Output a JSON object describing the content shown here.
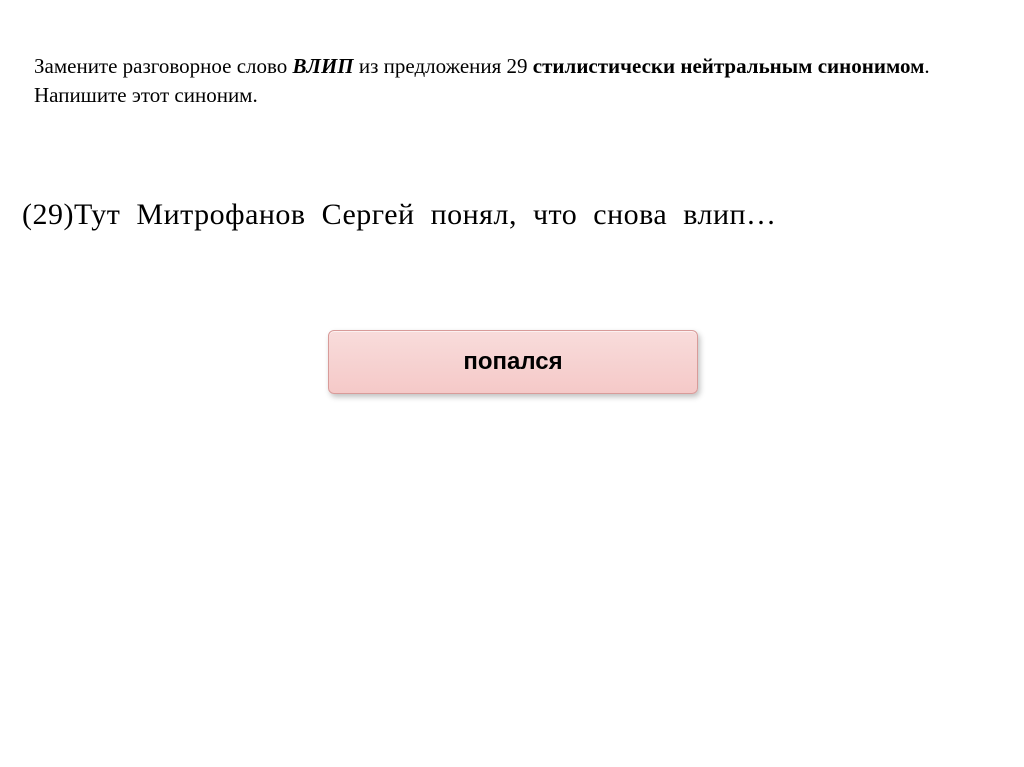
{
  "task": {
    "prefix": "Замените разговорное слово ",
    "keyword": "ВЛИП",
    "mid1": " из предложения 29 ",
    "bold_phrase": "стилистически нейтральным синонимом",
    "suffix": ". Напишите этот синоним."
  },
  "sentence": {
    "text": "(29)Тут Митрофанов Сергей понял, что снова влип…"
  },
  "answer": {
    "label": "попался"
  }
}
